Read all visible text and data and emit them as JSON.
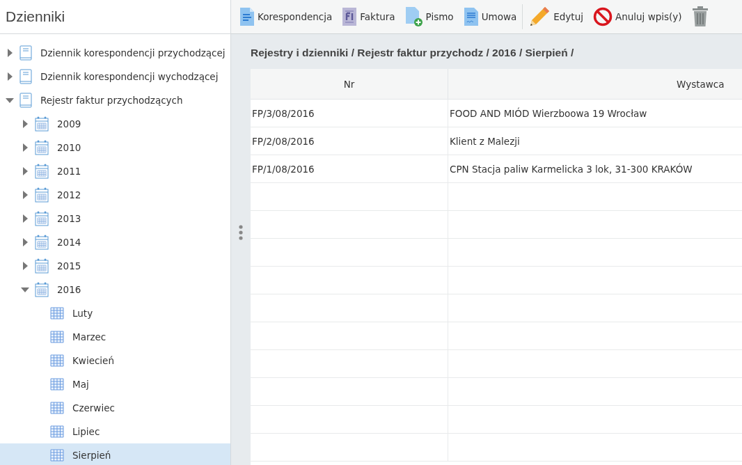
{
  "sidebar": {
    "title": "Dzienniki",
    "tree": [
      {
        "label": "Dziennik korespondencji przychodzącej",
        "kind": "journal",
        "expanded": false,
        "selected": false
      },
      {
        "label": "Dziennik korespondencji wychodzącej",
        "kind": "journal",
        "expanded": false,
        "selected": false
      },
      {
        "label": "Rejestr faktur przychodzących",
        "kind": "journal",
        "expanded": true,
        "selected": false,
        "children": [
          {
            "label": "2009",
            "kind": "year",
            "expanded": false,
            "selected": false
          },
          {
            "label": "2010",
            "kind": "year",
            "expanded": false,
            "selected": false
          },
          {
            "label": "2011",
            "kind": "year",
            "expanded": false,
            "selected": false
          },
          {
            "label": "2012",
            "kind": "year",
            "expanded": false,
            "selected": false
          },
          {
            "label": "2013",
            "kind": "year",
            "expanded": false,
            "selected": false
          },
          {
            "label": "2014",
            "kind": "year",
            "expanded": false,
            "selected": false
          },
          {
            "label": "2015",
            "kind": "year",
            "expanded": false,
            "selected": false
          },
          {
            "label": "2016",
            "kind": "year",
            "expanded": true,
            "selected": false,
            "children": [
              {
                "label": "Luty",
                "kind": "month",
                "selected": false
              },
              {
                "label": "Marzec",
                "kind": "month",
                "selected": false
              },
              {
                "label": "Kwiecień",
                "kind": "month",
                "selected": false
              },
              {
                "label": "Maj",
                "kind": "month",
                "selected": false
              },
              {
                "label": "Czerwiec",
                "kind": "month",
                "selected": false
              },
              {
                "label": "Lipiec",
                "kind": "month",
                "selected": false
              },
              {
                "label": "Sierpień",
                "kind": "month",
                "selected": true
              }
            ]
          }
        ]
      }
    ]
  },
  "toolbar": [
    {
      "label": "Korespondencja",
      "kind": "doc"
    },
    {
      "label": "Faktura",
      "kind": "invoice"
    },
    {
      "label": "Pismo",
      "kind": "add"
    },
    {
      "label": "Umowa",
      "kind": "contract"
    },
    {
      "label": "Edytuj",
      "kind": "edit"
    },
    {
      "label": "Anuluj wpis(y)",
      "kind": "cancel"
    },
    {
      "kind": "delete"
    }
  ],
  "breadcrumb": "Rejestry i dzienniki / Rejestr faktur przychodz / 2016 / Sierpień /",
  "table": {
    "columns": [
      "Nr",
      "Wystawca"
    ],
    "rows": [
      [
        "FP/3/08/2016",
        "FOOD AND MIÓD Wierzboowa 19 Wrocław"
      ],
      [
        "FP/2/08/2016",
        "Klient z Malezji"
      ],
      [
        "FP/1/08/2016",
        "CPN Stacja paliw Karmelicka 3 lok, 31-300 KRAKÓW"
      ]
    ]
  }
}
